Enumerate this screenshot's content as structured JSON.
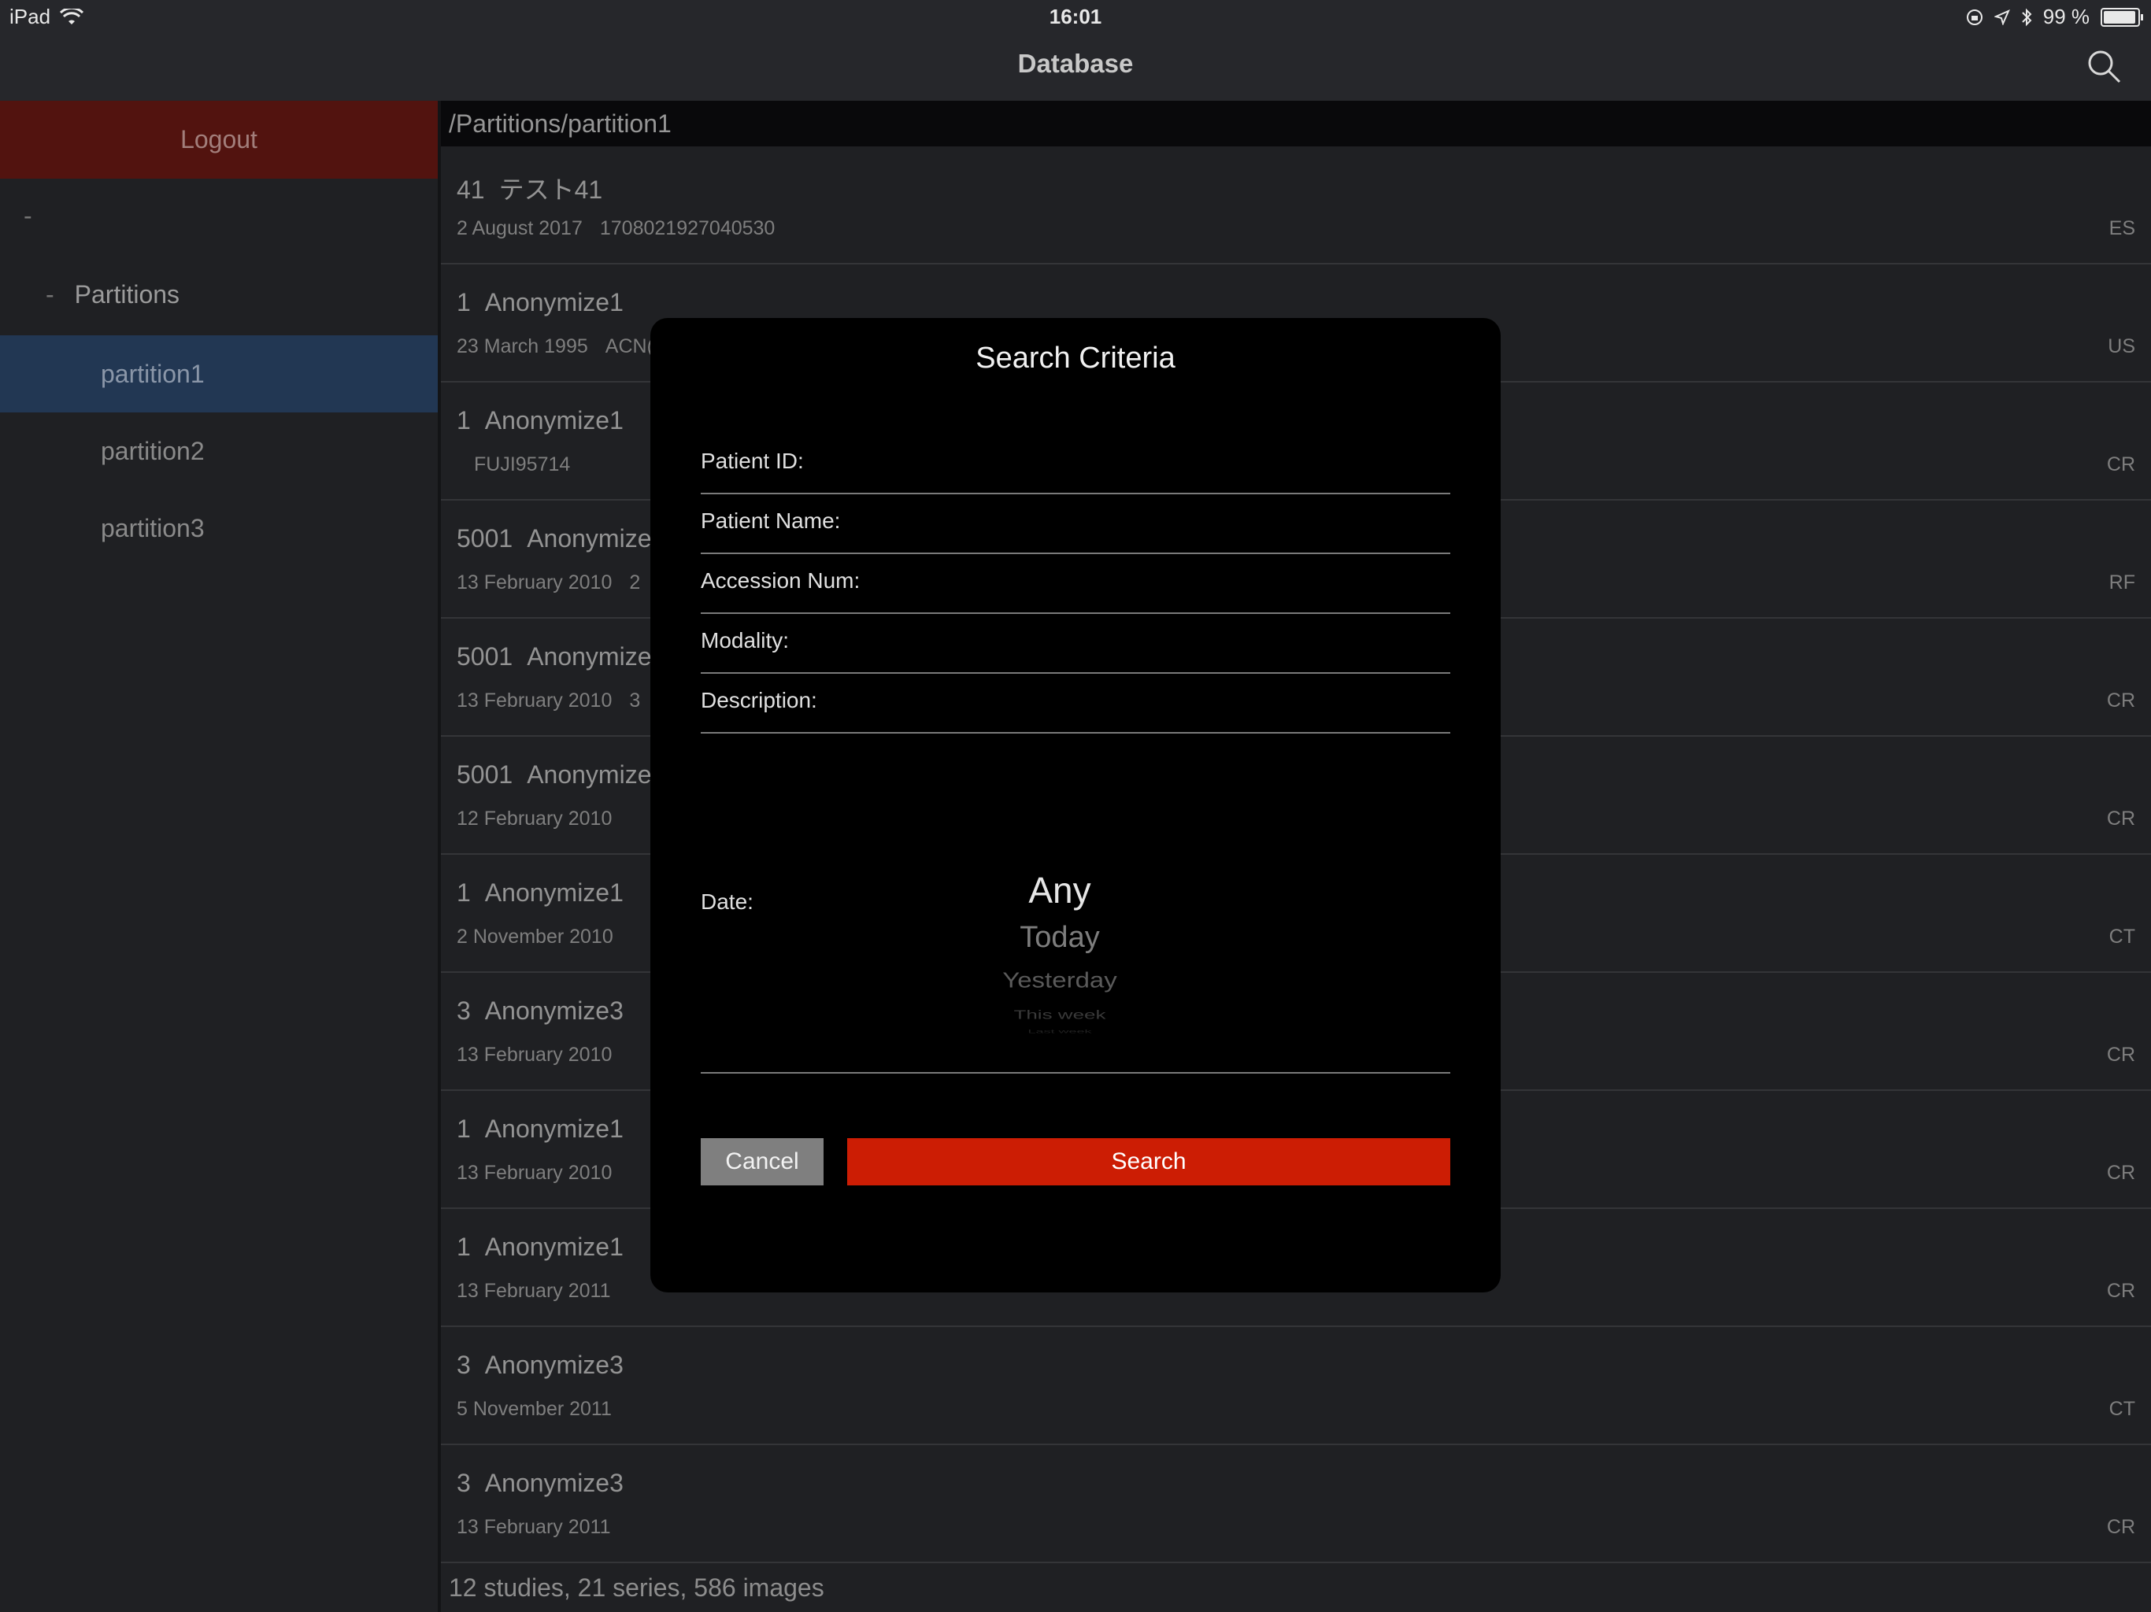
{
  "status_bar": {
    "device": "iPad",
    "time": "16:01",
    "battery_text": "99 %"
  },
  "nav": {
    "title": "Database"
  },
  "sidebar": {
    "logout_label": "Logout",
    "root_label": "-",
    "group_dash": "-",
    "group_label": "Partitions",
    "items": [
      {
        "label": "partition1",
        "selected": true
      },
      {
        "label": "partition2",
        "selected": false
      },
      {
        "label": "partition3",
        "selected": false
      }
    ]
  },
  "main": {
    "path": "/Partitions/partition1",
    "rows": [
      {
        "id": "41",
        "name": "テスト41",
        "date": "2 August 2017",
        "extra": "1708021927040530",
        "modality": "ES"
      },
      {
        "id": "1",
        "name": "Anonymize1",
        "date": "23 March 1995",
        "extra": "ACN(",
        "modality": "US"
      },
      {
        "id": "1",
        "name": "Anonymize1",
        "date": "",
        "extra": "FUJI95714",
        "modality": "CR"
      },
      {
        "id": "5001",
        "name": "Anonymize",
        "date": "13 February 2010",
        "extra": "2",
        "modality": "RF"
      },
      {
        "id": "5001",
        "name": "Anonymize",
        "date": "13 February 2010",
        "extra": "3",
        "modality": "CR"
      },
      {
        "id": "5001",
        "name": "Anonymize",
        "date": "12 February 2010",
        "extra": "",
        "modality": "CR"
      },
      {
        "id": "1",
        "name": "Anonymize1",
        "date": "2 November 2010",
        "extra": "",
        "modality": "CT"
      },
      {
        "id": "3",
        "name": "Anonymize3",
        "date": "13 February 2010",
        "extra": "",
        "modality": "CR"
      },
      {
        "id": "1",
        "name": "Anonymize1",
        "date": "13 February 2010",
        "extra": "",
        "modality": "CR"
      },
      {
        "id": "1",
        "name": "Anonymize1",
        "date": "13 February 2011",
        "extra": "",
        "modality": "CR"
      },
      {
        "id": "3",
        "name": "Anonymize3",
        "date": "5 November 2011",
        "extra": "",
        "modality": "CT"
      },
      {
        "id": "3",
        "name": "Anonymize3",
        "date": "13 February 2011",
        "extra": "",
        "modality": "CR"
      }
    ],
    "footer": "12 studies, 21 series, 586 images"
  },
  "modal": {
    "title": "Search Criteria",
    "fields": [
      {
        "label": "Patient ID:",
        "value": ""
      },
      {
        "label": "Patient Name:",
        "value": ""
      },
      {
        "label": "Accession Num:",
        "value": ""
      },
      {
        "label": "Modality:",
        "value": ""
      },
      {
        "label": "Description:",
        "value": ""
      }
    ],
    "date_label": "Date:",
    "date_options": [
      "Any",
      "Today",
      "Yesterday",
      "This week",
      "Last week"
    ],
    "cancel_label": "Cancel",
    "search_label": "Search"
  },
  "colors": {
    "logout_bg": "#6e1a14",
    "selected_bg": "#2e4a6f",
    "search_button": "#cc1d04",
    "cancel_button": "#7f7f7f"
  },
  "icons": [
    "wifi-icon",
    "search-icon",
    "location-icon",
    "bluetooth-icon",
    "battery-icon",
    "rotation-lock-icon"
  ]
}
